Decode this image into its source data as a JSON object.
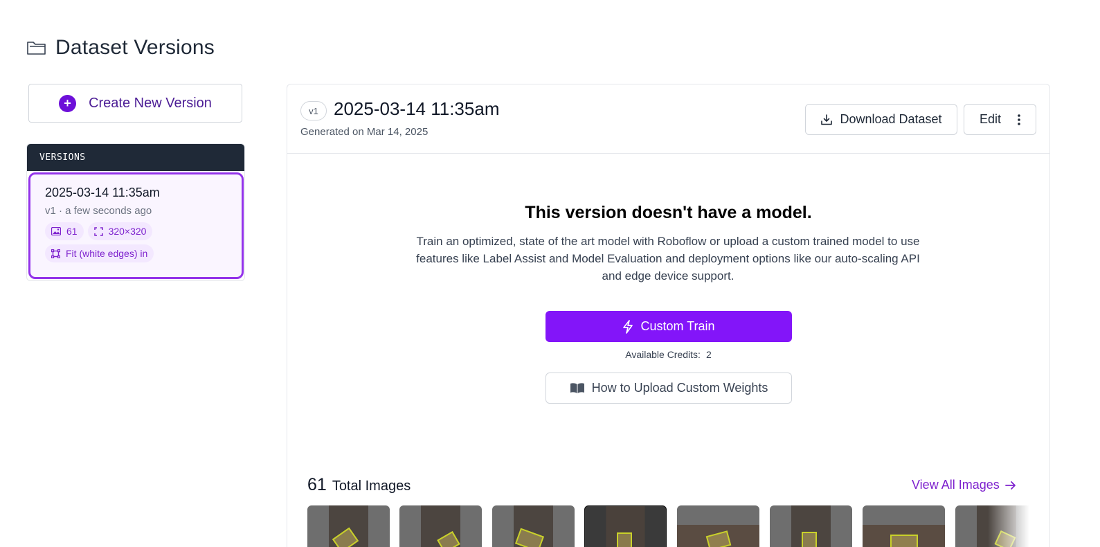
{
  "page": {
    "title": "Dataset Versions",
    "icon": "folder-icon"
  },
  "create_button": {
    "label": "Create New Version",
    "icon": "plus-circle-icon"
  },
  "versions": {
    "header": "VERSIONS",
    "items": [
      {
        "title": "2025-03-14 11:35am",
        "subtitle": "v1 · a few seconds ago",
        "image_count": "61",
        "size": "320×320",
        "preprocess": "Fit (white edges) in",
        "selected": true
      }
    ]
  },
  "version_detail": {
    "badge": "v1",
    "title": "2025-03-14 11:35am",
    "generated": "Generated on Mar 14, 2025",
    "download_label": "Download Dataset",
    "edit_label": "Edit",
    "empty_title": "This version doesn't have a model.",
    "empty_description": "Train an optimized, state of the art model with Roboflow or upload a custom trained model to use features like Label Assist and Model Evaluation and deployment options like our auto-scaling API and edge device support.",
    "train_label": "Custom Train",
    "credits_label": "Available Credits:",
    "credits_value": "2",
    "howto_label": "How to Upload Custom Weights",
    "total_count": "61",
    "total_label": "Total Images",
    "view_all_label": "View All Images"
  },
  "colors": {
    "accent": "#8315f9",
    "accent_dark": "#6d10d9",
    "selected_border": "#9333ea",
    "chip_bg": "#f3e8ff",
    "header_dark": "#1f2937"
  }
}
